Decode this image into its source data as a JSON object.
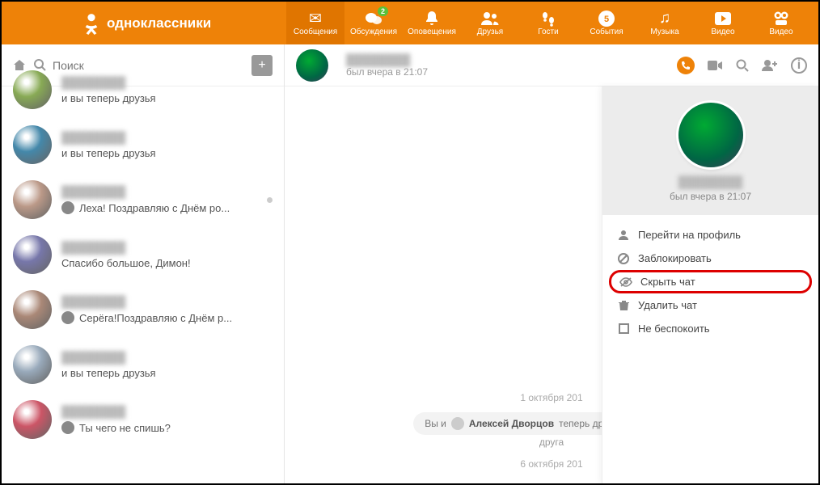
{
  "brand": {
    "name": "одноклассники"
  },
  "nav": {
    "items": [
      {
        "label": "Сообщения",
        "icon": "envelope",
        "active": true
      },
      {
        "label": "Обсуждения",
        "icon": "comments",
        "badge": "2"
      },
      {
        "label": "Оповещения",
        "icon": "bell"
      },
      {
        "label": "Друзья",
        "icon": "friends"
      },
      {
        "label": "Гости",
        "icon": "footprints"
      },
      {
        "label": "События",
        "icon": "thumb"
      },
      {
        "label": "Музыка",
        "icon": "music"
      },
      {
        "label": "Видео",
        "icon": "video"
      }
    ],
    "video_ext": {
      "label": "Видео",
      "icon": "webcam"
    }
  },
  "sidebar": {
    "search_placeholder": "Поиск",
    "chats": [
      {
        "name": "████████",
        "msg": "и вы теперь друзья"
      },
      {
        "name": "████████",
        "msg": "и вы теперь друзья"
      },
      {
        "name": "████████",
        "msg": "Леха! Поздравляю с Днём ро...",
        "mini": true,
        "unread": true
      },
      {
        "name": "████████",
        "msg": "Спасибо большое, Димон!"
      },
      {
        "name": "████████",
        "msg": "Серёга!Поздравляю с Днём р...",
        "mini": true
      },
      {
        "name": "████████",
        "msg": "и вы теперь друзья"
      },
      {
        "name": "████████",
        "msg": "Ты чего не спишь?",
        "mini": true
      }
    ]
  },
  "chat": {
    "title": "████████",
    "status": "был вчера в 21:07",
    "date1": "1 октября 201",
    "system_msg_pre": "Вы и ",
    "system_msg_name": "Алексей Дворцов",
    "system_msg_post": " теперь друзья на Однокла",
    "system_msg_line2": "друга",
    "date2": "6 октября 201"
  },
  "panel": {
    "name": "████████",
    "status": "был вчера в 21:07",
    "items": [
      {
        "label": "Перейти на профиль",
        "icon": "person"
      },
      {
        "label": "Заблокировать",
        "icon": "block"
      },
      {
        "label": "Скрыть чат",
        "icon": "eye-off",
        "highlight": true
      },
      {
        "label": "Удалить чат",
        "icon": "trash"
      },
      {
        "label": "Не беспокоить",
        "icon": "square"
      }
    ]
  }
}
